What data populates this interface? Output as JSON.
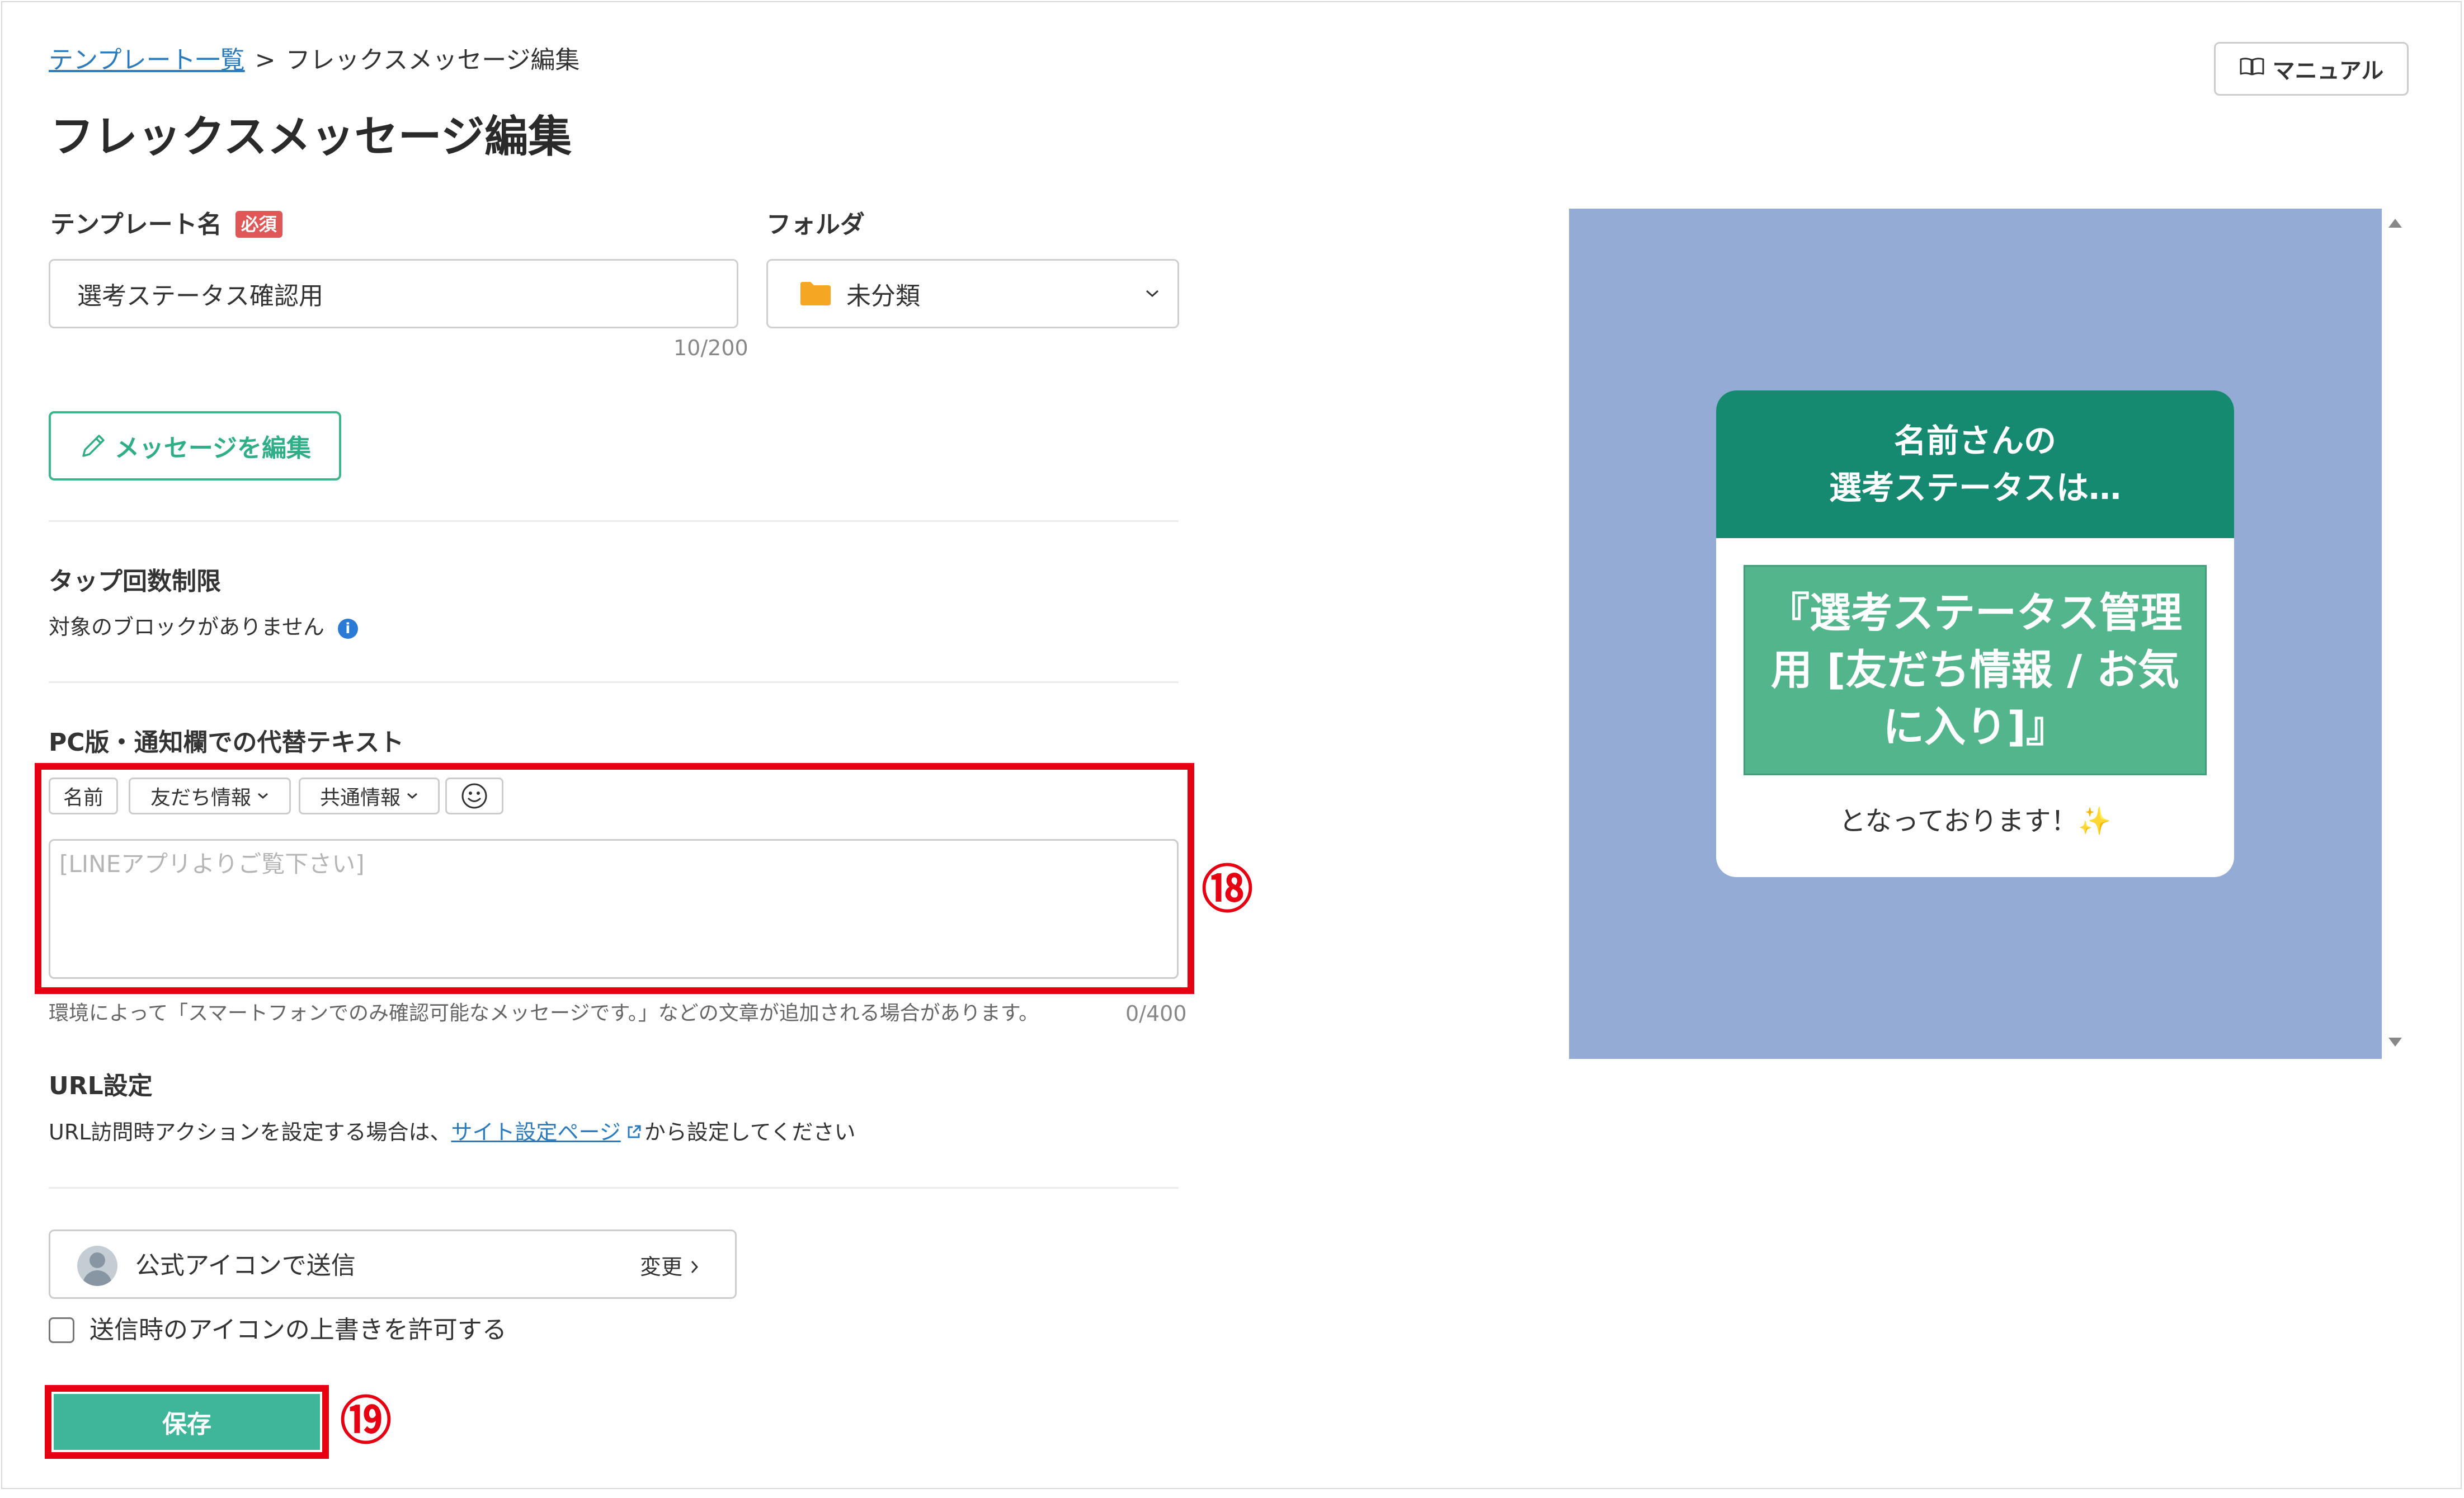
{
  "breadcrumb": {
    "parent": "テンプレート一覧",
    "separator": ">",
    "current": "フレックスメッセージ編集"
  },
  "header": {
    "manual_label": "マニュアル",
    "title": "フレックスメッセージ編集"
  },
  "form": {
    "template_name": {
      "label": "テンプレート名",
      "required_badge": "必須",
      "value": "選考ステータス確認用",
      "counter": "10/200"
    },
    "folder": {
      "label": "フォルダ",
      "value": "未分類"
    },
    "edit_message_label": "メッセージを編集",
    "tap_limit": {
      "label": "タップ回数制限",
      "description": "対象のブロックがありません"
    },
    "alt_text": {
      "label": "PC版・通知欄での代替テキスト",
      "chips": {
        "name": "名前",
        "friend_info": "友だち情報",
        "common_info": "共通情報"
      },
      "placeholder": "[LINEアプリよりご覧下さい]",
      "hint": "環境によって「スマートフォンでのみ確認可能なメッセージです。」などの文章が追加される場合があります。",
      "counter": "0/400"
    },
    "url_settings": {
      "label": "URL設定",
      "text_before": "URL訪問時アクションを設定する場合は、",
      "link": "サイト設定ページ",
      "text_after": "から設定してください"
    },
    "sender": {
      "label": "公式アイコンで送信",
      "change_label": "変更"
    },
    "override_icon_label": "送信時のアイコンの上書きを許可する",
    "save_label": "保存"
  },
  "annotations": {
    "marker_18": "⑱",
    "marker_19": "⑲",
    "highlight_color": "#e60012"
  },
  "preview": {
    "header_line1": "名前さんの",
    "header_line2": "選考ステータスは…",
    "body_text": "『選考ステータス管理用 [友だち情報 / お気に入り]』",
    "footer_text": "となっております！",
    "footer_emoji": "✨",
    "colors": {
      "background": "#94abd6",
      "header": "#168a70",
      "body_box": "#52b58c"
    }
  }
}
